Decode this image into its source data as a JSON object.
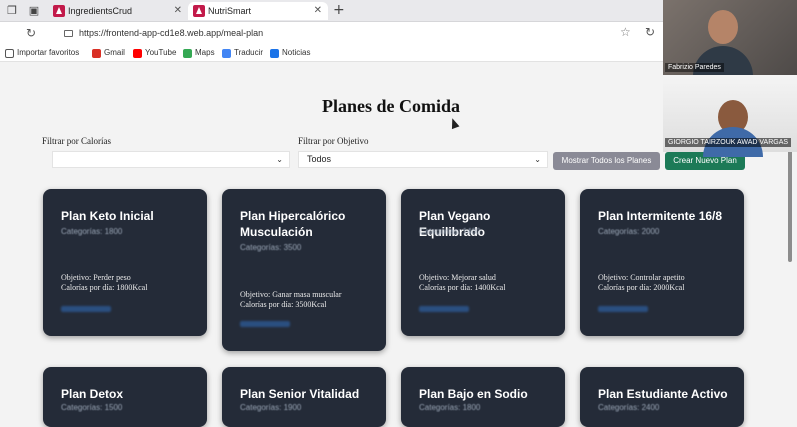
{
  "browser": {
    "tabs": [
      {
        "label": "IngredientsCrud"
      },
      {
        "label": "NutriSmart"
      }
    ],
    "url": "https://frontend-app-cd1e8.web.app/meal-plan",
    "bookmarks": [
      {
        "label": "Importar favoritos"
      },
      {
        "label": "Gmail"
      },
      {
        "label": "YouTube"
      },
      {
        "label": "Maps"
      },
      {
        "label": "Traducir"
      },
      {
        "label": "Noticias"
      }
    ]
  },
  "page": {
    "title": "Planes de Comida",
    "filters": {
      "calories_label": "Filtrar por Calorías",
      "calories_value": "",
      "objective_label": "Filtrar por Objetivo",
      "objective_value": "Todos"
    },
    "buttons": {
      "show_all": "Mostrar Todos los Planes",
      "create": "Crear Nuevo Plan"
    }
  },
  "cards": [
    {
      "name": "Plan Keto Inicial",
      "category": "Categorías: 1800",
      "objective": "Objetivo: Perder peso",
      "calories": "Calorías por día: 1800Kcal"
    },
    {
      "name": "Plan Hipercalórico Musculación",
      "category": "Categorías: 3500",
      "objective": "Objetivo: Ganar masa muscular",
      "calories": "Calorías por día: 3500Kcal"
    },
    {
      "name": "Plan Vegano Equilibrado",
      "category": "Categorías: 1400",
      "objective": "Objetivo: Mejorar salud",
      "calories": "Calorías por día: 1400Kcal"
    },
    {
      "name": "Plan Intermitente 16/8",
      "category": "Categorías: 2000",
      "objective": "Objetivo: Controlar apetito",
      "calories": "Calorías por día: 2000Kcal"
    },
    {
      "name": "Plan Detox",
      "category": "Categorías: 1500"
    },
    {
      "name": "Plan Senior Vitalidad",
      "category": "Categorías: 1900"
    },
    {
      "name": "Plan Bajo en Sodio",
      "category": "Categorías: 1800"
    },
    {
      "name": "Plan Estudiante Activo",
      "category": "Categorías: 2400"
    }
  ],
  "video_call": {
    "participants": [
      {
        "name": "Fabrizio Paredes"
      },
      {
        "name": "GIORGIO TAIRZOUK AWAD VARGAS"
      }
    ]
  },
  "colors": {
    "card_bg": "#242b38",
    "create_button": "#1c7a57",
    "show_all_button": "#8a8a96",
    "tab_favicon": "#c21a4a"
  }
}
